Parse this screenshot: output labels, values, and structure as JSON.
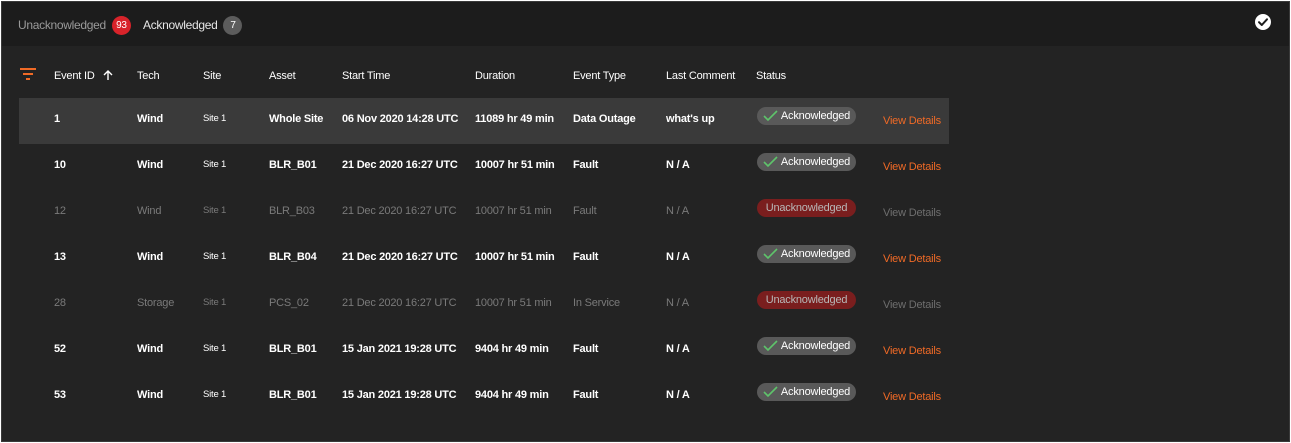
{
  "tabs": {
    "unacknowledged": {
      "label": "Unacknowledged",
      "count": "93"
    },
    "acknowledged": {
      "label": "Acknowledged",
      "count": "7"
    }
  },
  "icons": {
    "filter": "filter-icon",
    "sort": "arrow-up-icon",
    "check": "check-circle-icon",
    "pill_check": "checkmark-icon"
  },
  "colors": {
    "accent": "#f06a26",
    "badge_red": "#d8232a",
    "badge_grey": "#5c5c5c",
    "check_green": "#5ec46b",
    "unack_pill": "#7a1e1e"
  },
  "table": {
    "columns": [
      "Event ID",
      "Tech",
      "Site",
      "Asset",
      "Start Time",
      "Duration",
      "Event Type",
      "Last Comment",
      "Status"
    ],
    "rows": [
      {
        "id": "1",
        "tech": "Wind",
        "site": "Site 1",
        "asset": "Whole Site",
        "start": "06 Nov 2020 14:28 UTC",
        "duration": "11089 hr 49 min",
        "type": "Data Outage",
        "comment": "what's up",
        "status": "Acknowledged",
        "acknowledged": true,
        "link": "View Details"
      },
      {
        "id": "10",
        "tech": "Wind",
        "site": "Site 1",
        "asset": "BLR_B01",
        "start": "21 Dec 2020 16:27 UTC",
        "duration": "10007 hr 51 min",
        "type": "Fault",
        "comment": "N / A",
        "status": "Acknowledged",
        "acknowledged": true,
        "link": "View Details"
      },
      {
        "id": "12",
        "tech": "Wind",
        "site": "Site 1",
        "asset": "BLR_B03",
        "start": "21 Dec 2020 16:27 UTC",
        "duration": "10007 hr 51 min",
        "type": "Fault",
        "comment": "N / A",
        "status": "Unacknowledged",
        "acknowledged": false,
        "link": "View Details"
      },
      {
        "id": "13",
        "tech": "Wind",
        "site": "Site 1",
        "asset": "BLR_B04",
        "start": "21 Dec 2020 16:27 UTC",
        "duration": "10007 hr 51 min",
        "type": "Fault",
        "comment": "N / A",
        "status": "Acknowledged",
        "acknowledged": true,
        "link": "View Details"
      },
      {
        "id": "28",
        "tech": "Storage",
        "site": "Site 1",
        "asset": "PCS_02",
        "start": "21 Dec 2020 16:27 UTC",
        "duration": "10007 hr 51 min",
        "type": "In Service",
        "comment": "N / A",
        "status": "Unacknowledged",
        "acknowledged": false,
        "link": "View Details"
      },
      {
        "id": "52",
        "tech": "Wind",
        "site": "Site 1",
        "asset": "BLR_B01",
        "start": "15 Jan 2021 19:28 UTC",
        "duration": "9404 hr 49 min",
        "type": "Fault",
        "comment": "N / A",
        "status": "Acknowledged",
        "acknowledged": true,
        "link": "View Details"
      },
      {
        "id": "53",
        "tech": "Wind",
        "site": "Site 1",
        "asset": "BLR_B01",
        "start": "15 Jan 2021 19:28 UTC",
        "duration": "9404 hr 49 min",
        "type": "Fault",
        "comment": "N / A",
        "status": "Acknowledged",
        "acknowledged": true,
        "link": "View Details"
      }
    ]
  }
}
